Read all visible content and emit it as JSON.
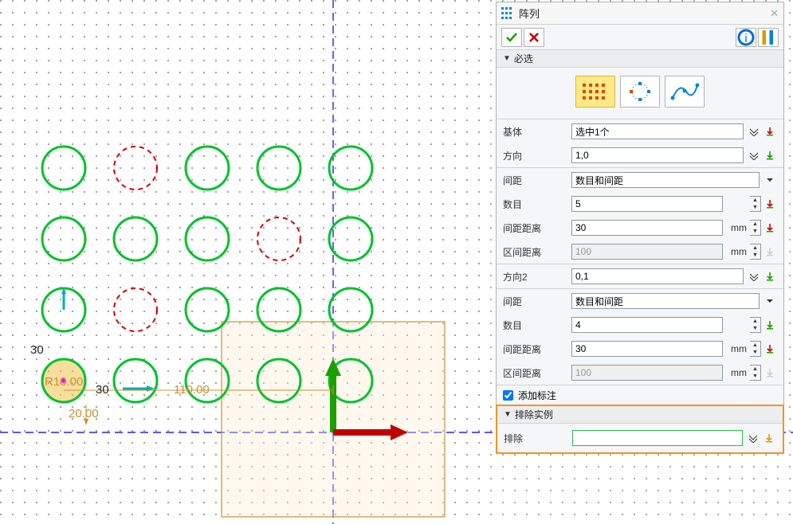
{
  "panel": {
    "title": "阵列",
    "required_hdr": "必选",
    "exclude_hdr": "排除实例",
    "base_label": "基体",
    "base_value": "选中1个",
    "dir_label": "方向",
    "dir_value": "1,0",
    "spacing_label": "间距",
    "spacing_value": "数目和间距",
    "count_label": "数目",
    "count_value": "5",
    "gapdist_label": "间距距离",
    "gapdist_value": "30",
    "rangedist_label": "区间距离",
    "rangedist_value": "100",
    "dir2_label": "方向2",
    "dir2_value": "0,1",
    "spacing2_value": "数目和间距",
    "count2_value": "4",
    "gapdist2_value": "30",
    "rangedist2_value": "100",
    "unit": "mm",
    "add_annot": "添加标注",
    "exclude_label": "排除",
    "exclude_value": ""
  },
  "canvas": {
    "dim30a": "30",
    "dim30b": "30",
    "dim110": "110.00",
    "dim20": "20.00",
    "dimR10": "R10.00"
  },
  "chart_data": null
}
